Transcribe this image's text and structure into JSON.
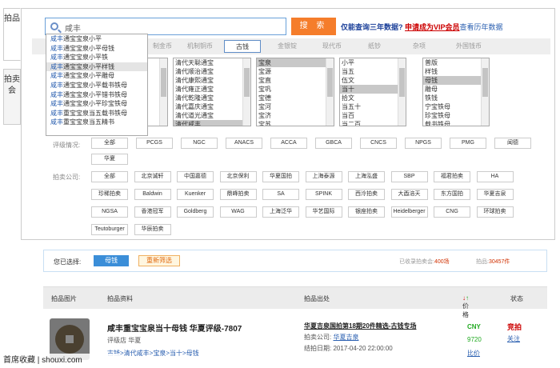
{
  "side_tabs": [
    "拍品",
    "拍卖会"
  ],
  "search": {
    "value": "咸丰",
    "button": "搜 索"
  },
  "tip": {
    "text": "仅能查询三年数据?",
    "link": "申请成为VIP会员",
    "suffix": "查看历年数据"
  },
  "suggestions": [
    {
      "hl": "咸丰",
      "rest": "通宝宝泉小平"
    },
    {
      "hl": "咸丰",
      "rest": "通宝宝泉小平母钱"
    },
    {
      "hl": "咸丰",
      "rest": "通宝宝泉小平铁"
    },
    {
      "hl": "咸丰",
      "rest": "通宝宝泉小平样钱"
    },
    {
      "hl": "咸丰",
      "rest": "通宝宝泉小平雕母"
    },
    {
      "hl": "咸丰",
      "rest": "通宝宝泉小平载书铁母"
    },
    {
      "hl": "咸丰",
      "rest": "通宝宝泉小平错书铁母"
    },
    {
      "hl": "咸丰",
      "rest": "通宝宝泉小平珍宝铁母"
    },
    {
      "hl": "咸丰",
      "rest": "重宝宝泉当五载书铁母"
    },
    {
      "hl": "咸丰",
      "rest": "重宝宝泉当五精书"
    }
  ],
  "categories": [
    "制金币",
    "机制铜币",
    "古钱",
    "金银锭",
    "现代币",
    "纸钞",
    "杂项",
    "外国钱币"
  ],
  "list1": [
    "清代天聪通宝",
    "清代顺治通宝",
    "清代康熙通宝",
    "清代雍正通宝",
    "清代乾隆通宝",
    "清代嘉庆通宝",
    "清代道光通宝",
    "清代咸丰"
  ],
  "list2": [
    "宝泉",
    "宝源",
    "宝直",
    "宝巩",
    "宝德",
    "宝河",
    "宝济",
    "宝苏"
  ],
  "list3": [
    "小平",
    "当五",
    "伍文",
    "当十",
    "拾文",
    "当五十",
    "当百",
    "当二百"
  ],
  "list4": [
    "普版",
    "样钱",
    "母钱",
    "雕母",
    "铁钱",
    "宁宝铁母",
    "珍宝铁母",
    "载书铁母"
  ],
  "grade_label": "评级情况:",
  "grades": [
    "全部",
    "PCGS",
    "NGC",
    "ANACS",
    "ACCA",
    "GBCA",
    "CNCS",
    "NPGS",
    "PMG",
    "闻德",
    "华夏"
  ],
  "company_label": "拍卖公司:",
  "companies": [
    "全部",
    "北京诚轩",
    "中国嘉德",
    "北京保利",
    "华夏国拍",
    "上海泰源",
    "上海泓盛",
    "SBP",
    "福君拍卖",
    "HA",
    "珍稀拍卖",
    "Baldwin",
    "Kuenker",
    "鼎峰拍卖",
    "SA",
    "SPINK",
    "西泠拍卖",
    "大酉涪天",
    "东方国拍",
    "华夏吉泉",
    "NGSA",
    "香港冠军",
    "Goldberg",
    "WAG",
    "上海泛华",
    "华艺国际",
    "银座拍卖",
    "Heidelberger",
    "CNG",
    "环球拍卖",
    "Teutoburger",
    "华辰拍卖"
  ],
  "selected": {
    "label": "您已选择:",
    "chip": "母钱",
    "reset": "重新筛选",
    "count_label": "已收录拍卖会:",
    "count": "400场",
    "lots_label": "拍品:",
    "lots": "30457件"
  },
  "thead": {
    "img": "拍品图片",
    "info": "拍品资料",
    "source": "拍品出处",
    "price": "价格",
    "status": "状态"
  },
  "row": {
    "title": "咸丰重宝宝泉当十母钱 华夏评级-7807",
    "grade": "评级店 华夏",
    "path": "古钱>清代咸丰>宝泉>当十>母钱",
    "auction": "华夏吉泉国拍第18期20件精选-古钱专场",
    "house_label": "拍卖公司:",
    "house": "华夏吉泉",
    "date_label": "结拍日期:",
    "date": "2017-04-20 22:00:00",
    "cur": "CNY",
    "price": "9720",
    "compare": "比价",
    "status": "竞拍",
    "follow": "关注"
  },
  "watermark": "首席收藏 | shouxi.com"
}
